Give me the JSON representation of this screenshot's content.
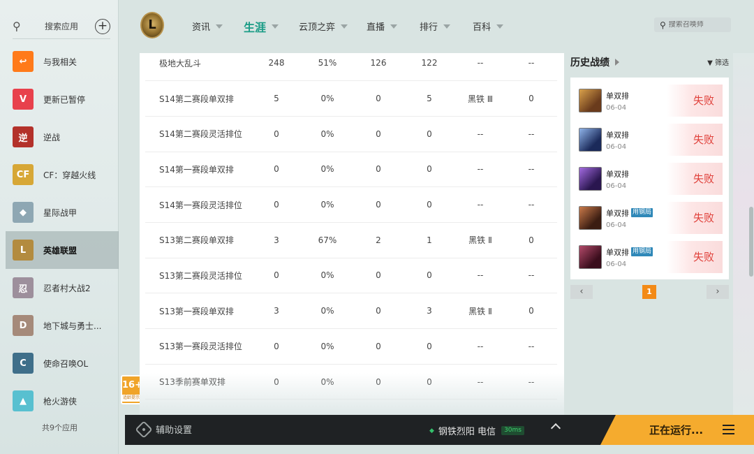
{
  "sidebar": {
    "search_label": "搜索应用",
    "apps": [
      {
        "name": "与我相关",
        "color": "#ff7a1a",
        "glyph": "↩"
      },
      {
        "name": "更新已暂停",
        "color": "#e8414c",
        "glyph": "V"
      },
      {
        "name": "逆战",
        "color": "#b3312a",
        "glyph": "逆"
      },
      {
        "name": "CF：穿越火线",
        "color": "#d7a736",
        "glyph": "CF"
      },
      {
        "name": "星际战甲",
        "color": "#8ea7b3",
        "glyph": "◆"
      },
      {
        "name": "英雄联盟",
        "color": "#b38b3f",
        "glyph": "L"
      },
      {
        "name": "忍者村大战2",
        "color": "#9d8f9c",
        "glyph": "忍"
      },
      {
        "name": "地下城与勇士...",
        "color": "#a58a7a",
        "glyph": "D"
      },
      {
        "name": "使命召唤OL",
        "color": "#3f6f8a",
        "glyph": "C"
      },
      {
        "name": "枪火游侠",
        "color": "#58c0d0",
        "glyph": "▲"
      }
    ],
    "active_index": 5,
    "app_count": "共9个应用"
  },
  "age_badge": {
    "rating": "16+",
    "caption": "适龄提示"
  },
  "topnav": {
    "items": [
      "资讯",
      "生涯",
      "云顶之弈",
      "直播",
      "排行",
      "百科"
    ],
    "active": "生涯",
    "search_placeholder": "搜索召唤师"
  },
  "ranked_table": {
    "rows": [
      [
        "极地大乱斗",
        "248",
        "51%",
        "126",
        "122",
        "--",
        "--"
      ],
      [
        "S14第二赛段单双排",
        "5",
        "0%",
        "0",
        "5",
        "黑铁 Ⅲ",
        "0"
      ],
      [
        "S14第二赛段灵活排位",
        "0",
        "0%",
        "0",
        "0",
        "--",
        "--"
      ],
      [
        "S14第一赛段单双排",
        "0",
        "0%",
        "0",
        "0",
        "--",
        "--"
      ],
      [
        "S14第一赛段灵活排位",
        "0",
        "0%",
        "0",
        "0",
        "--",
        "--"
      ],
      [
        "S13第二赛段单双排",
        "3",
        "67%",
        "2",
        "1",
        "黑铁 Ⅱ",
        "0"
      ],
      [
        "S13第二赛段灵活排位",
        "0",
        "0%",
        "0",
        "0",
        "--",
        "--"
      ],
      [
        "S13第一赛段单双排",
        "3",
        "0%",
        "0",
        "3",
        "黑铁 Ⅱ",
        "0"
      ],
      [
        "S13第一赛段灵活排位",
        "0",
        "0%",
        "0",
        "0",
        "--",
        "--"
      ],
      [
        "S13季前赛单双排",
        "0",
        "0%",
        "0",
        "0",
        "--",
        "--"
      ]
    ]
  },
  "history": {
    "title": "历史战绩",
    "filter_label": "筛选",
    "matches": [
      {
        "type": "单双排",
        "tag": "",
        "date": "06-04",
        "result": "失败",
        "c1": "#6a3b1c",
        "c2": "#d9a14b"
      },
      {
        "type": "单双排",
        "tag": "",
        "date": "06-04",
        "result": "失败",
        "c1": "#1b2a5a",
        "c2": "#8fb3e8"
      },
      {
        "type": "单双排",
        "tag": "",
        "date": "06-04",
        "result": "失败",
        "c1": "#2a164f",
        "c2": "#a36be0"
      },
      {
        "type": "单双排",
        "tag": "用钢局",
        "date": "06-04",
        "result": "失败",
        "c1": "#3b1d12",
        "c2": "#c97a4a"
      },
      {
        "type": "单双排",
        "tag": "用钢局",
        "date": "06-04",
        "result": "失败",
        "c1": "#3a0d1c",
        "c2": "#b24a6a"
      }
    ],
    "page": "1"
  },
  "bottombar": {
    "assist_label": "辅助设置",
    "server": "钢铁烈阳 电信",
    "ping": "30ms",
    "running_label": "正在运行..."
  }
}
